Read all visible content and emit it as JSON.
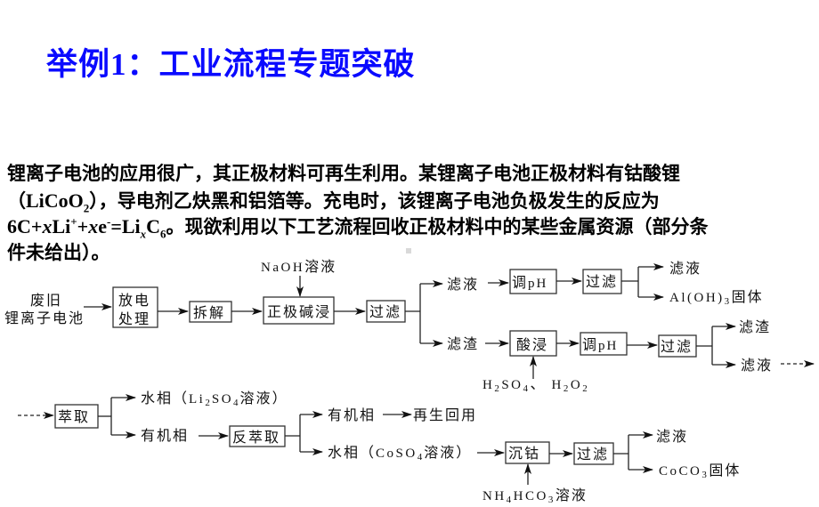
{
  "title": {
    "prefix": "举例",
    "number": "1",
    "rest": "：工业流程专题突破"
  },
  "paragraph": {
    "line1": "锂离子电池的应用很广，其正极材料可再生利用。某锂离子电池正极材料有钴酸锂",
    "line2_open": "（",
    "line2_formula_main": "LiCoO",
    "line2_formula_sub": "2",
    "line2_rest": "），导电剂乙炔黑和铝箔等。充电时，该锂离子电池负极发生的反应为",
    "line3_eq_a": "6C+",
    "line3_eq_x1": "x",
    "line3_eq_b": "Li",
    "line3_eq_sup1": "+",
    "line3_eq_c": "+",
    "line3_eq_x2": "x",
    "line3_eq_d": "e",
    "line3_eq_sup2": "-",
    "line3_eq_e": "=Li",
    "line3_eq_subx": "x",
    "line3_eq_f": "C",
    "line3_eq_sub6": "6",
    "line3_rest": "。现欲利用以下工艺流程回收正极材料中的某些金属资源（部分条",
    "line4": "件未给出）。"
  },
  "flowchart": {
    "start_label_line1": "废旧",
    "start_label_line2": "锂离子电池",
    "naoh_label_chem": "NaOH",
    "naoh_label_cn": "溶液",
    "boxes": {
      "discharge_line1": "放电",
      "discharge_line2": "处理",
      "dismantle": "拆解",
      "alkali_leach": "正极碱浸",
      "filter1": "过滤",
      "adjust_ph1_cn": "调",
      "adjust_ph1_chem": "pH",
      "filter2": "过滤",
      "acid_leach": "酸浸",
      "adjust_ph2_cn": "调",
      "adjust_ph2_chem": "pH",
      "filter3": "过滤",
      "extraction": "萃取",
      "back_extraction": "反萃取",
      "cobalt_precip": "沉钴",
      "filter4": "过滤"
    },
    "labels": {
      "filtrate1": "滤液",
      "residue1": "滤渣",
      "filtrate_top": "滤液",
      "aloh3_chem_a": "Al(OH)",
      "aloh3_sub": "3",
      "aloh3_cn": "固体",
      "residue2": "滤渣",
      "filtrate2": "滤液",
      "acid_reagent_h": "H",
      "acid_reagent_sub1": "2",
      "acid_reagent_so": "SO",
      "acid_reagent_sub2": "4",
      "acid_reagent_sep": "、",
      "acid_reagent_h2": "H",
      "acid_reagent_sub3": "2",
      "acid_reagent_o": "O",
      "acid_reagent_sub4": "2",
      "aqueous1_a": "水相（",
      "aqueous1_li": "Li",
      "aqueous1_sub1": "2",
      "aqueous1_so": "SO",
      "aqueous1_sub2": "4",
      "aqueous1_cn": "溶液",
      "aqueous1_close": "）",
      "organic1": "有机相",
      "organic2": "有机相",
      "recycle": "再生回用",
      "aqueous2_a": "水相（",
      "aqueous2_coso": "CoSO",
      "aqueous2_sub": "4",
      "aqueous2_cn": "溶液",
      "aqueous2_close": "）",
      "nh4hco3_n": "NH",
      "nh4hco3_sub1": "4",
      "nh4hco3_hco": "HCO",
      "nh4hco3_sub2": "3",
      "nh4hco3_cn": "溶液",
      "filtrate3": "滤液",
      "coco3_chem": "CoCO",
      "coco3_sub": "3",
      "coco3_cn": "固体"
    }
  }
}
